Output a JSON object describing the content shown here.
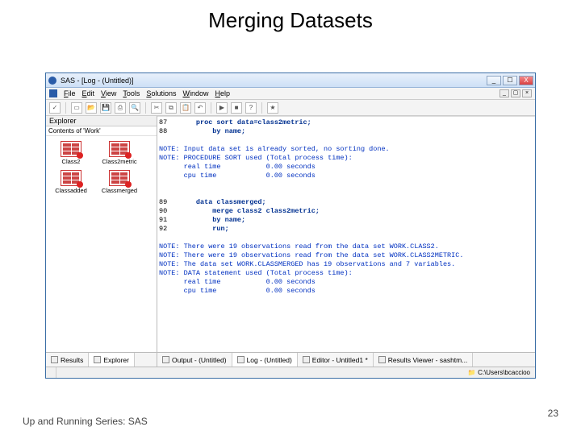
{
  "slide": {
    "title": "Merging Datasets",
    "footer_series": "Up and Running Series: SAS",
    "page_number": "23"
  },
  "window": {
    "title": "SAS - [Log - (Untitled)]",
    "minimize": "_",
    "maximize": "☐",
    "close": "X"
  },
  "menu": {
    "file": "File",
    "edit": "Edit",
    "view": "View",
    "tools": "Tools",
    "solutions": "Solutions",
    "window": "Window",
    "help": "Help"
  },
  "explorer": {
    "title": "Explorer",
    "subtitle": "Contents of 'Work'",
    "items": [
      {
        "label": "Class2"
      },
      {
        "label": "Class2metric"
      },
      {
        "label": "Classadded"
      },
      {
        "label": "Classmerged"
      }
    ]
  },
  "log": {
    "lines": [
      {
        "cls": "ln",
        "t": "87"
      },
      {
        "cls": "kw",
        "t": "       proc sort data=class2metric;"
      },
      {
        "cls": "ln",
        "t": "88"
      },
      {
        "cls": "kw",
        "t": "           by name;"
      },
      {
        "cls": "blank",
        "t": ""
      },
      {
        "cls": "note",
        "t": "NOTE: Input data set is already sorted, no sorting done."
      },
      {
        "cls": "note",
        "t": "NOTE: PROCEDURE SORT used (Total process time):"
      },
      {
        "cls": "note",
        "t": "      real time           0.00 seconds"
      },
      {
        "cls": "note",
        "t": "      cpu time            0.00 seconds"
      },
      {
        "cls": "blank",
        "t": ""
      },
      {
        "cls": "blank",
        "t": ""
      },
      {
        "cls": "ln",
        "t": "89"
      },
      {
        "cls": "kw",
        "t": "       data classmerged;"
      },
      {
        "cls": "ln",
        "t": "90"
      },
      {
        "cls": "kw",
        "t": "           merge class2 class2metric;"
      },
      {
        "cls": "ln",
        "t": "91"
      },
      {
        "cls": "kw",
        "t": "           by name;"
      },
      {
        "cls": "ln",
        "t": "92"
      },
      {
        "cls": "kw",
        "t": "           run;"
      },
      {
        "cls": "blank",
        "t": ""
      },
      {
        "cls": "note",
        "t": "NOTE: There were 19 observations read from the data set WORK.CLASS2."
      },
      {
        "cls": "note",
        "t": "NOTE: There were 19 observations read from the data set WORK.CLASS2METRIC."
      },
      {
        "cls": "note",
        "t": "NOTE: The data set WORK.CLASSMERGED has 19 observations and 7 variables."
      },
      {
        "cls": "note",
        "t": "NOTE: DATA statement used (Total process time):"
      },
      {
        "cls": "note",
        "t": "      real time           0.00 seconds"
      },
      {
        "cls": "note",
        "t": "      cpu time            0.00 seconds"
      }
    ]
  },
  "tabs": {
    "left": [
      {
        "label": "Results"
      },
      {
        "label": "Explorer"
      }
    ],
    "right": [
      {
        "label": "Output - (Untitled)"
      },
      {
        "label": "Log - (Untitled)"
      },
      {
        "label": "Editor - Untitled1 *"
      },
      {
        "label": "Results Viewer - sashtm..."
      }
    ]
  },
  "status": {
    "path": "C:\\Users\\bcaccioo"
  }
}
